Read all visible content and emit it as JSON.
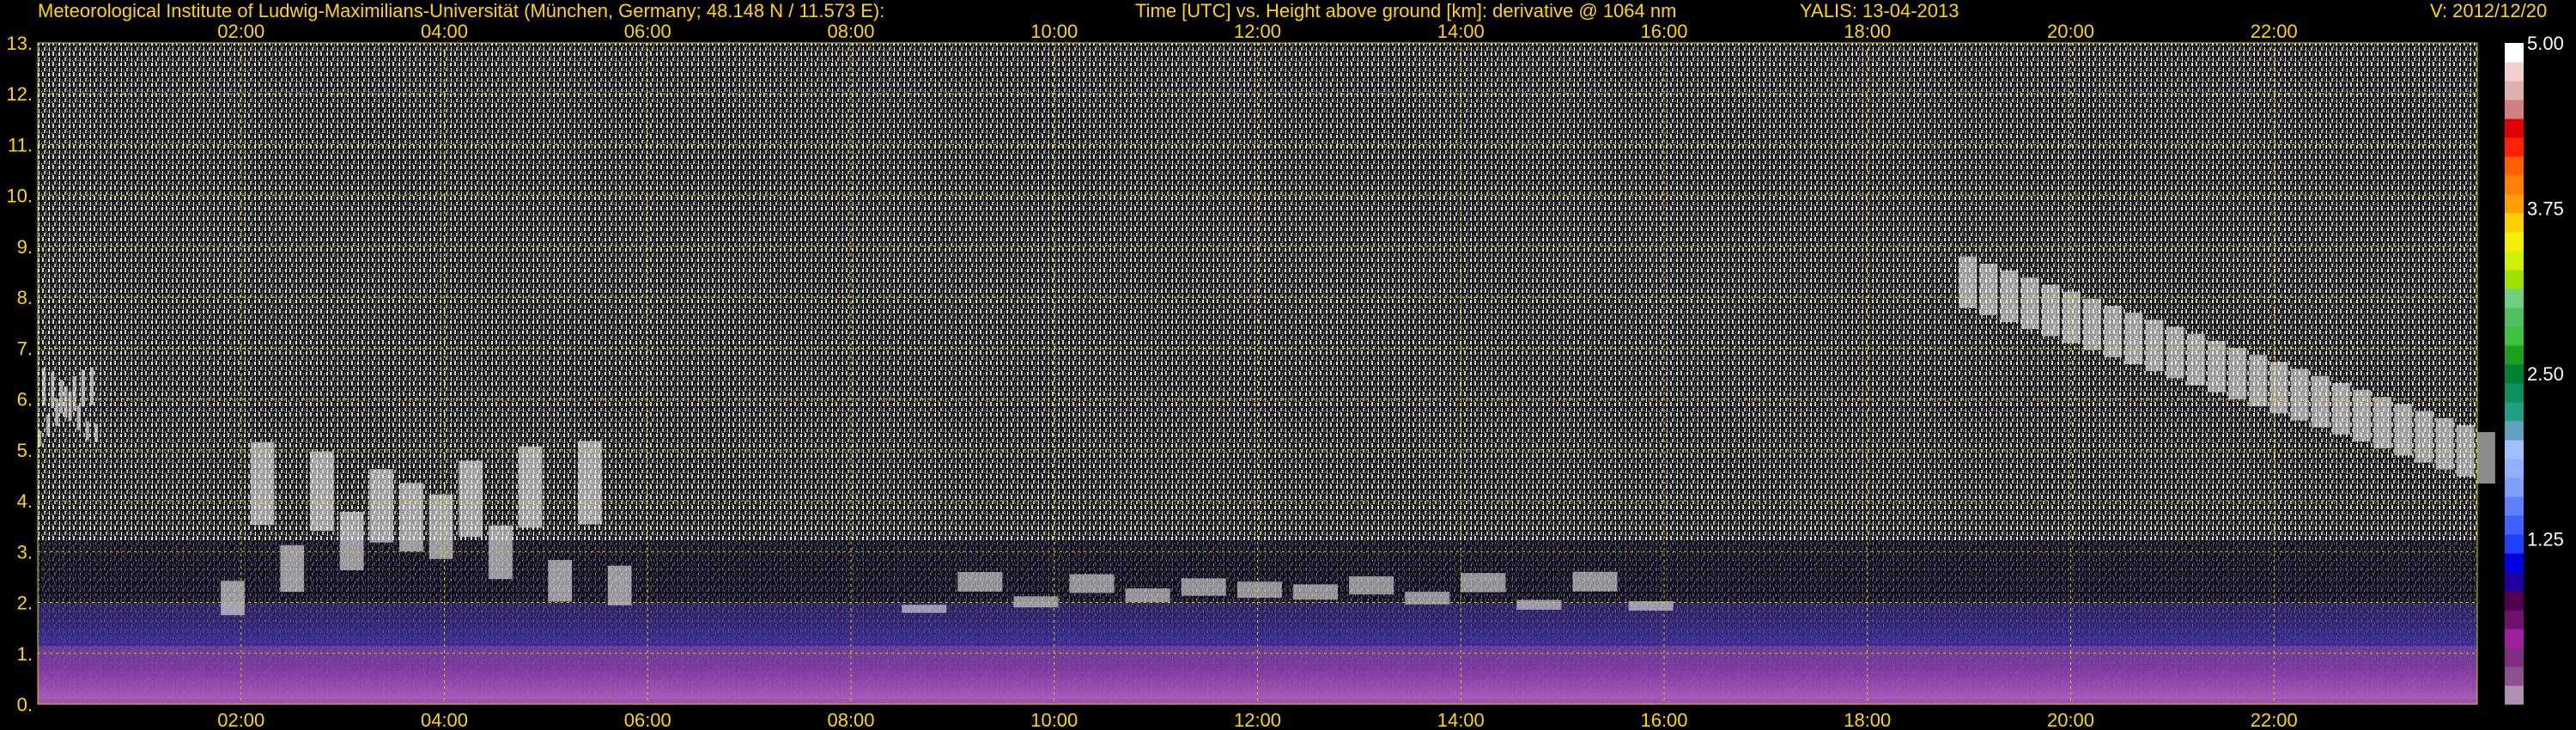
{
  "header": {
    "institute": "Meteorological Institute of Ludwig-Maximilians-Universität (München, Germany; 48.148 N / 11.573 E):",
    "axes_title": "Time [UTC] vs. Height above ground [km]: derivative @ 1064 nm",
    "instrument": "YALIS: 13-04-2013",
    "version": "V: 2012/12/20"
  },
  "colors": {
    "text": "#ffd700",
    "grid": "#d8d000",
    "background": "#000000"
  },
  "chart_data": {
    "type": "heatmap",
    "title": "Time [UTC] vs. Height above ground [km]: derivative @ 1064 nm",
    "xlabel": "",
    "ylabel": "",
    "xlim": [
      0.0,
      24.0
    ],
    "ylim": [
      0,
      13
    ],
    "x_tick_labels": [
      "02:00",
      "04:00",
      "06:00",
      "08:00",
      "10:00",
      "12:00",
      "14:00",
      "16:00",
      "18:00",
      "20:00",
      "22:00"
    ],
    "x_tick_hours": [
      2,
      4,
      6,
      8,
      10,
      12,
      14,
      16,
      18,
      20,
      22
    ],
    "y_tick_labels": [
      "0.",
      "1.",
      "2.",
      "3.",
      "4.",
      "5.",
      "6.",
      "7.",
      "8.",
      "9.",
      "10.",
      "11.",
      "12.",
      "13."
    ],
    "y_tick_values": [
      0,
      1,
      2,
      3,
      4,
      5,
      6,
      7,
      8,
      9,
      10,
      11,
      12,
      13
    ],
    "grid": true,
    "colorbar": {
      "range": [
        0,
        5.0
      ],
      "tick_labels": [
        "5.00",
        "3.75",
        "2.50",
        "1.25"
      ],
      "tick_values": [
        5.0,
        3.75,
        2.5,
        1.25
      ],
      "colors": [
        "#b090b0",
        "#905090",
        "#803080",
        "#a020a0",
        "#701070",
        "#500050",
        "#2000a0",
        "#0000e0",
        "#2040ff",
        "#4060ff",
        "#6080ff",
        "#80a0ff",
        "#90b0ff",
        "#a0c0ff",
        "#60a0c0",
        "#20a080",
        "#109060",
        "#008030",
        "#20a020",
        "#40c040",
        "#50c060",
        "#70d080",
        "#a0e000",
        "#d0f000",
        "#f0f000",
        "#ffd000",
        "#ffa000",
        "#ff8000",
        "#ff6000",
        "#ff2000",
        "#e00000",
        "#d08080",
        "#e0b0b0",
        "#f0d0d0",
        "#ffffff"
      ]
    },
    "features": [
      {
        "name": "boundary-layer-aerosol",
        "time_range": [
          0.0,
          24.0
        ],
        "height_range_km": [
          0.1,
          2.0
        ]
      },
      {
        "name": "morning-clouds",
        "time_range": [
          1.8,
          5.9
        ],
        "height_range_km": [
          0.5,
          6.0
        ]
      },
      {
        "name": "early-cloud",
        "time_range": [
          0.0,
          0.6
        ],
        "height_range_km": [
          4.5,
          7.0
        ]
      },
      {
        "name": "midday-cloud-tops",
        "time_range": [
          8.5,
          16.2
        ],
        "height_range_km": [
          1.5,
          2.8
        ]
      },
      {
        "name": "evening-cirrus",
        "time_range": [
          18.9,
          24.0
        ],
        "height_range_km": [
          4.2,
          8.8
        ]
      }
    ]
  }
}
